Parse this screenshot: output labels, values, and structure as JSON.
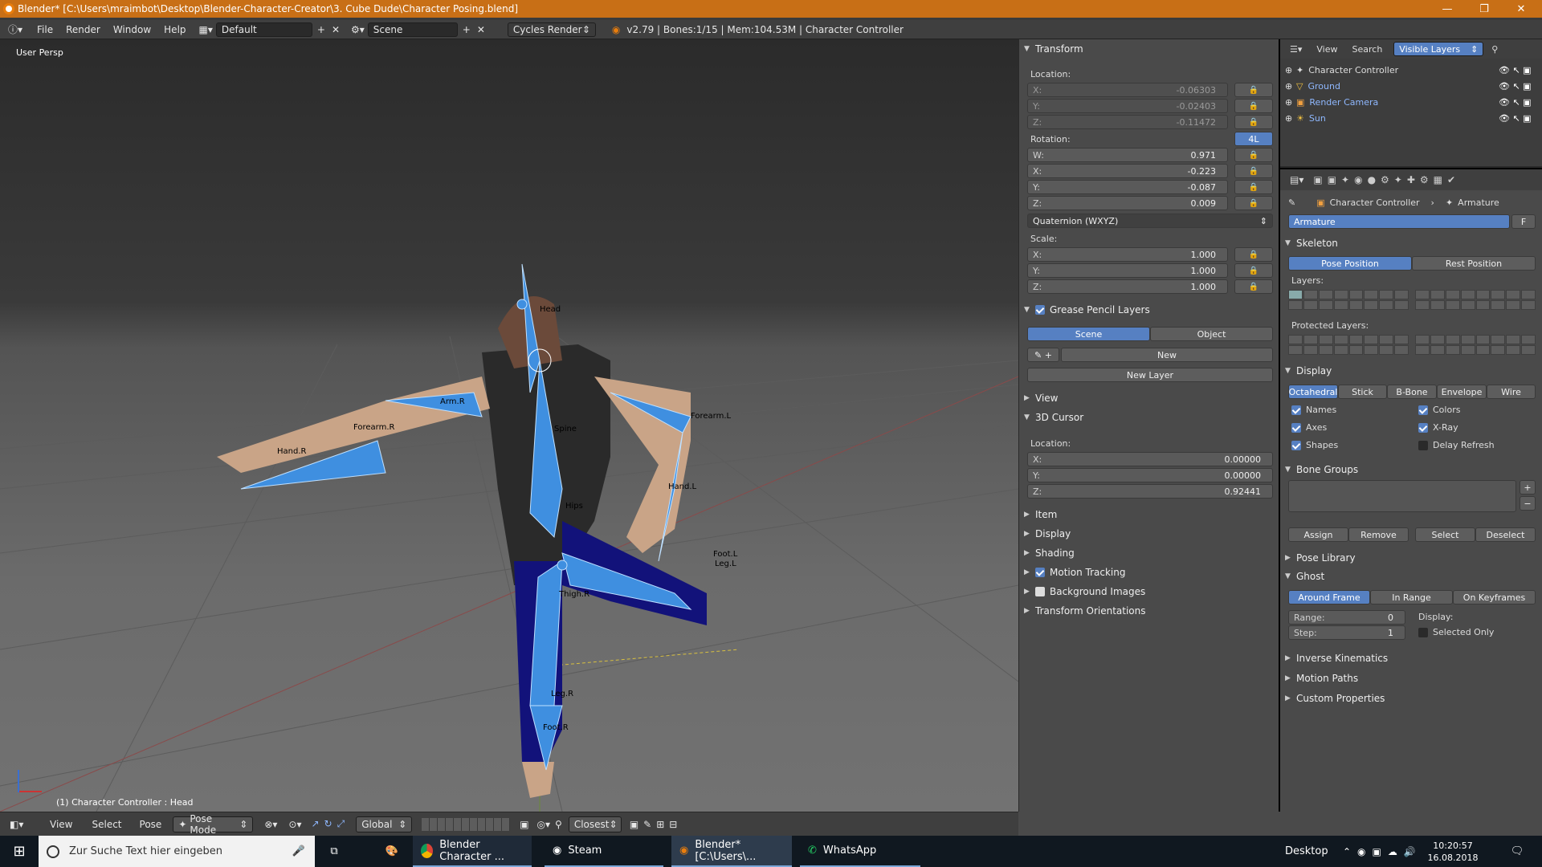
{
  "titlebar": {
    "text": "Blender* [C:\\Users\\mraimbot\\Desktop\\Blender-Character-Creator\\3. Cube Dude\\Character Posing.blend]",
    "min": "—",
    "max": "❐",
    "close": "✕"
  },
  "info": {
    "menus": [
      "File",
      "Render",
      "Window",
      "Help"
    ],
    "layout": "Default",
    "scene": "Scene",
    "engine": "Cycles Render",
    "stats": "v2.79 | Bones:1/15  | Mem:104.53M | Character Controller"
  },
  "viewport": {
    "view_name": "User Persp",
    "selection": "(1) Character Controller : Head",
    "bone_labels": [
      "Head",
      "Arm.R",
      "Forearm.R",
      "Hand.R",
      "Spine",
      "Forearm.L",
      "Hand.L",
      "Hips",
      "Foot.L",
      "Leg.L",
      "Thigh.R",
      "Leg.R",
      "Foot.R"
    ]
  },
  "npanel": {
    "transform": {
      "title": "Transform",
      "location_label": "Location:",
      "location": [
        {
          "k": "X:",
          "v": "-0.06303"
        },
        {
          "k": "Y:",
          "v": "-0.02403"
        },
        {
          "k": "Z:",
          "v": "-0.11472"
        }
      ],
      "rotation_label": "Rotation:",
      "rot_lock": "4L",
      "rotation": [
        {
          "k": "W:",
          "v": "0.971"
        },
        {
          "k": "X:",
          "v": "-0.223"
        },
        {
          "k": "Y:",
          "v": "-0.087"
        },
        {
          "k": "Z:",
          "v": "0.009"
        }
      ],
      "mode": "Quaternion (WXYZ)",
      "scale_label": "Scale:",
      "scale": [
        {
          "k": "X:",
          "v": "1.000"
        },
        {
          "k": "Y:",
          "v": "1.000"
        },
        {
          "k": "Z:",
          "v": "1.000"
        }
      ]
    },
    "grease": {
      "title": "Grease Pencil Layers",
      "scene": "Scene",
      "object": "Object",
      "new": "New",
      "new_layer": "New Layer"
    },
    "view": "View",
    "cursor": {
      "title": "3D Cursor",
      "location_label": "Location:",
      "values": [
        {
          "k": "X:",
          "v": "0.00000"
        },
        {
          "k": "Y:",
          "v": "0.00000"
        },
        {
          "k": "Z:",
          "v": "0.92441"
        }
      ]
    },
    "sections": [
      "Item",
      "Display",
      "Shading",
      "Motion Tracking",
      "Background Images",
      "Transform Orientations"
    ]
  },
  "outliner": {
    "menus": [
      "View",
      "Search"
    ],
    "filter": "Visible Layers",
    "items": [
      {
        "name": "Character Controller",
        "color": "#ffffff"
      },
      {
        "name": "Ground",
        "color": "#f0c040"
      },
      {
        "name": "Render Camera",
        "color": "#8fb8ff"
      },
      {
        "name": "Sun",
        "color": "#f0c040"
      }
    ]
  },
  "props": {
    "crumb_obj": "Character Controller",
    "crumb_data": "Armature",
    "datablock": "Armature",
    "fake": "F",
    "skeleton": {
      "title": "Skeleton",
      "pose": "Pose Position",
      "rest": "Rest Position",
      "layers": "Layers:",
      "protected": "Protected Layers:"
    },
    "display": {
      "title": "Display",
      "modes": [
        "Octahedral",
        "Stick",
        "B-Bone",
        "Envelope",
        "Wire"
      ],
      "checks": [
        {
          "label": "Names",
          "on": true
        },
        {
          "label": "Colors",
          "on": true
        },
        {
          "label": "Axes",
          "on": true
        },
        {
          "label": "X-Ray",
          "on": true
        },
        {
          "label": "Shapes",
          "on": true
        },
        {
          "label": "Delay Refresh",
          "on": false
        }
      ]
    },
    "bone_groups": {
      "title": "Bone Groups",
      "assign": "Assign",
      "remove": "Remove",
      "select": "Select",
      "deselect": "Deselect"
    },
    "pose_library": "Pose Library",
    "ghost": {
      "title": "Ghost",
      "modes": [
        "Around Frame",
        "In Range",
        "On Keyframes"
      ],
      "range_k": "Range:",
      "range_v": "0",
      "step_k": "Step:",
      "step_v": "1",
      "display": "Display:",
      "selected_only": "Selected Only"
    },
    "more": [
      "Inverse Kinematics",
      "Motion Paths",
      "Custom Properties"
    ]
  },
  "vphead": {
    "menus": [
      "View",
      "Select",
      "Pose"
    ],
    "mode": "Pose Mode",
    "orientation": "Global",
    "snap": "Closest"
  },
  "taskbar": {
    "search": "Zur Suche Text hier eingeben",
    "apps": [
      "Blender Character ...",
      "Steam",
      "Blender* [C:\\Users\\...",
      "WhatsApp"
    ],
    "desktop": "Desktop",
    "time": "10:20:57",
    "date": "16.08.2018"
  }
}
